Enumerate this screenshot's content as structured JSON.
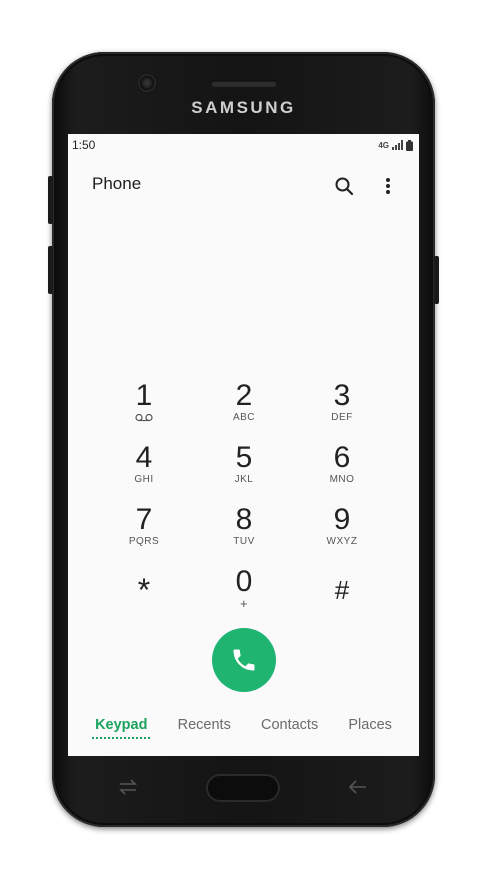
{
  "device": {
    "brand": "SAMSUNG"
  },
  "status_bar": {
    "time": "1:50",
    "network": "4G"
  },
  "header": {
    "title": "Phone",
    "search_icon": "search-icon",
    "more_icon": "more-vert-icon"
  },
  "keypad": {
    "keys": [
      {
        "digit": "1",
        "letters": ""
      },
      {
        "digit": "2",
        "letters": "ABC"
      },
      {
        "digit": "3",
        "letters": "DEF"
      },
      {
        "digit": "4",
        "letters": "GHI"
      },
      {
        "digit": "5",
        "letters": "JKL"
      },
      {
        "digit": "6",
        "letters": "MNO"
      },
      {
        "digit": "7",
        "letters": "PQRS"
      },
      {
        "digit": "8",
        "letters": "TUV"
      },
      {
        "digit": "9",
        "letters": "WXYZ"
      },
      {
        "digit": "*",
        "letters": ""
      },
      {
        "digit": "0",
        "letters": "+"
      },
      {
        "digit": "#",
        "letters": ""
      }
    ]
  },
  "call": {
    "icon": "phone-icon",
    "color": "#1fb46f"
  },
  "tabs": [
    {
      "label": "Keypad",
      "active": true
    },
    {
      "label": "Recents",
      "active": false
    },
    {
      "label": "Contacts",
      "active": false
    },
    {
      "label": "Places",
      "active": false
    }
  ],
  "colors": {
    "accent": "#1aa35e"
  }
}
